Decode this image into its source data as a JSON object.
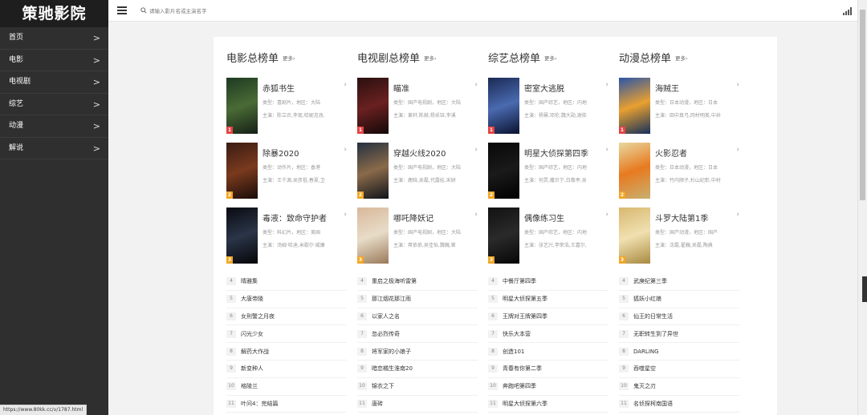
{
  "logo": "策驰影院",
  "nav": [
    {
      "label": "首页"
    },
    {
      "label": "电影"
    },
    {
      "label": "电视剧"
    },
    {
      "label": "综艺"
    },
    {
      "label": "动漫"
    },
    {
      "label": "解说"
    }
  ],
  "nav_arrow": ">",
  "search": {
    "placeholder": "请输入影片名或主演名字",
    "value": ""
  },
  "colors": {
    "gold": "#f5a623",
    "red": "#e64343",
    "sidebar": "#2f2f2f"
  },
  "columns": [
    {
      "title": "电影总榜单",
      "more": "更多›",
      "top": [
        {
          "rank": "1",
          "title": "赤狐书生",
          "meta": "类型：喜剧片，地区：大陆",
          "cast": "主演：陈立农,李现,哈妮克孜,",
          "poster": [
            "#1e3a22",
            "#4a6b35",
            "#152016"
          ]
        },
        {
          "rank": "2",
          "title": "除暴2020",
          "meta": "类型：动作片，地区：香港",
          "cast": "主演：王千源,吴彦祖,春夏,卫",
          "poster": [
            "#3a1c12",
            "#7a3a1e",
            "#1a0c08"
          ]
        },
        {
          "rank": "3",
          "title": "毒液：致命守护者",
          "meta": "类型：科幻片，地区：美国",
          "cast": "主演：汤姆·哈迪,米歇尔·威廉",
          "poster": [
            "#0a0a10",
            "#2a3548",
            "#050507"
          ]
        }
      ],
      "list": [
        {
          "rank": "4",
          "title": "晴雅集"
        },
        {
          "rank": "5",
          "title": "大唐帝陵"
        },
        {
          "rank": "6",
          "title": "女刑警之月夜"
        },
        {
          "rank": "7",
          "title": "闪光少女"
        },
        {
          "rank": "8",
          "title": "解药大作战"
        },
        {
          "rank": "9",
          "title": "新变种人"
        },
        {
          "rank": "10",
          "title": "格陵兰"
        },
        {
          "rank": "11",
          "title": "叶问4：完结篇"
        }
      ]
    },
    {
      "title": "电视剧总榜单",
      "more": "更多›",
      "top": [
        {
          "rank": "1",
          "title": "瞄准",
          "meta": "类型：国产电视剧，地区：大陆",
          "cast": "主演：黄轩,陈赫,杨采钰,李溪",
          "poster": [
            "#2a1010",
            "#6a2020",
            "#140808"
          ]
        },
        {
          "rank": "2",
          "title": "穿越火线2020",
          "meta": "类型：国产电视剧，地区：大陆",
          "cast": "主演：鹿晗,吴磊,代露娃,宋妍",
          "poster": [
            "#243040",
            "#8a6a4a",
            "#10141a"
          ]
        },
        {
          "rank": "3",
          "title": "哪吒降妖记",
          "meta": "类型：国产电视剧，地区：大陆",
          "cast": "主演：蒋依依,吴佳怡,魏巍,崔",
          "poster": [
            "#d8b89a",
            "#e8dcc8",
            "#9a7a5a"
          ]
        }
      ],
      "list": [
        {
          "rank": "4",
          "title": "重启之极海听雷第"
        },
        {
          "rank": "5",
          "title": "那江烟花那江雨"
        },
        {
          "rank": "6",
          "title": "以家人之名"
        },
        {
          "rank": "7",
          "title": "忽必烈传奇"
        },
        {
          "rank": "8",
          "title": "将军家的小娘子"
        },
        {
          "rank": "9",
          "title": "暗恋橘生淮南20"
        },
        {
          "rank": "10",
          "title": "锦衣之下"
        },
        {
          "rank": "11",
          "title": "唐砖"
        }
      ]
    },
    {
      "title": "综艺总榜单",
      "more": "更多›",
      "top": [
        {
          "rank": "1",
          "title": "密室大逃脱",
          "meta": "类型：国产综艺，地区：内地",
          "cast": "主演：杨幂,邓伦,魏大勋,谢依",
          "poster": [
            "#1a2a55",
            "#4a6ab0",
            "#0a1230"
          ]
        },
        {
          "rank": "2",
          "title": "明星大侦探第四季",
          "meta": "类型：国产综艺，地区：内地",
          "cast": "主演：何炅,撒贝宁,白敬亭,吴",
          "poster": [
            "#080808",
            "#1a1a1a",
            "#000000"
          ]
        },
        {
          "rank": "3",
          "title": "偶像练习生",
          "meta": "类型：国产综艺，地区：内地",
          "cast": "主演：张艺兴,李荣浩,王嘉尔,",
          "poster": [
            "#121212",
            "#2a2a2a",
            "#060606"
          ]
        }
      ],
      "list": [
        {
          "rank": "4",
          "title": "中餐厅第四季"
        },
        {
          "rank": "5",
          "title": "明星大侦探第五季"
        },
        {
          "rank": "6",
          "title": "王牌对王牌第四季"
        },
        {
          "rank": "7",
          "title": "快乐大本营"
        },
        {
          "rank": "8",
          "title": "创造101"
        },
        {
          "rank": "9",
          "title": "青春有你第二季"
        },
        {
          "rank": "10",
          "title": "奔跑吧第四季"
        },
        {
          "rank": "11",
          "title": "明星大侦探第六季"
        }
      ]
    },
    {
      "title": "动漫总榜单",
      "more": "更多›",
      "top": [
        {
          "rank": "1",
          "title": "海贼王",
          "meta": "类型：日本动漫，地区：日本",
          "cast": "主演：田中真弓,冈村明美,中井",
          "poster": [
            "#2a55a8",
            "#e8a030",
            "#14305a"
          ]
        },
        {
          "rank": "2",
          "title": "火影忍者",
          "meta": "类型：日本动漫，地区：日本",
          "cast": "主演：竹内顺子,杉山纪彰,中村",
          "poster": [
            "#e8d8a0",
            "#e87a20",
            "#c8b070"
          ]
        },
        {
          "rank": "3",
          "title": "斗罗大陆第1季",
          "meta": "类型：国产动漫，地区：国产",
          "cast": "主演：沈磊,翟巍,吴磊,陶典",
          "poster": [
            "#d8b870",
            "#f0e0b0",
            "#a88a40"
          ]
        }
      ],
      "list": [
        {
          "rank": "4",
          "title": "武庚纪第三季"
        },
        {
          "rank": "5",
          "title": "狐妖小红娘"
        },
        {
          "rank": "6",
          "title": "仙王的日常生活"
        },
        {
          "rank": "7",
          "title": "无职转生到了异世"
        },
        {
          "rank": "8",
          "title": "DARLING"
        },
        {
          "rank": "9",
          "title": "吞噬星空"
        },
        {
          "rank": "10",
          "title": "鬼灭之刃"
        },
        {
          "rank": "11",
          "title": "名侦探柯南国语"
        }
      ]
    }
  ],
  "status_url": "https://www.80kk.cc/v/1787.html"
}
